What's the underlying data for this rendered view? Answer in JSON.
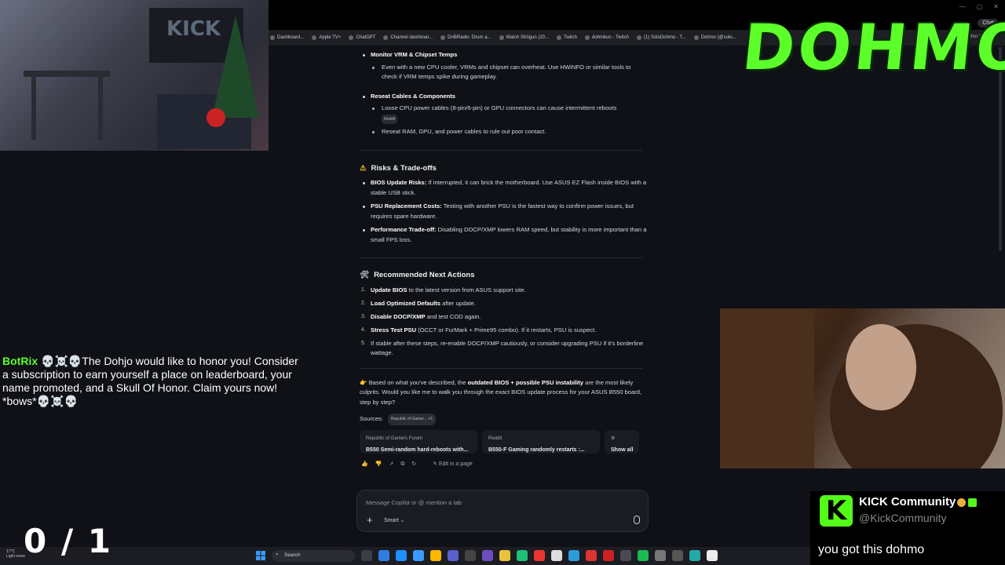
{
  "browser": {
    "bookmarks": [
      "Dashboard...",
      "Apple TV+",
      "ChatGPT",
      "Channel dashboar...",
      "DnBRadio: Drum a...",
      "Watch Shōgun (20...",
      "Twitch",
      "dohmkun - Twitch",
      "(1) SoloDohmo - T...",
      "Dohmo (@solo..."
    ],
    "chat_button": "Chat",
    "other_favorites": "Other favorites"
  },
  "copilot": {
    "top_items": [
      {
        "title": "Monitor VRM & Chipset Temps",
        "bullets": [
          "Even with a new CPU cooler, VRMs and chipset can overheat. Use HWiNFO or similar tools to check if VRM temps spike during gameplay."
        ]
      },
      {
        "title": "Reseat Cables & Components",
        "bullets": [
          "Loose CPU power cables (8-pin/6-pin) or GPU connectors can cause intermittent reboots",
          "Reseat RAM, GPU, and power cables to rule out poor contact."
        ],
        "tag": "Reddit"
      }
    ],
    "risks": {
      "heading": "Risks & Trade-offs",
      "items": [
        {
          "bold": "BIOS Update Risks:",
          "text": " If interrupted, it can brick the motherboard. Use ASUS EZ Flash inside BIOS with a stable USB stick."
        },
        {
          "bold": "PSU Replacement Costs:",
          "text": " Testing with another PSU is the fastest way to confirm power issues, but requires spare hardware."
        },
        {
          "bold": "Performance Trade-off:",
          "text": " Disabling DOCP/XMP lowers RAM speed, but stability is more important than a small FPS loss."
        }
      ]
    },
    "next": {
      "heading": "Recommended Next Actions",
      "items": [
        {
          "n": "1.",
          "bold": "Update BIOS",
          "text": " to the latest version from ASUS support site."
        },
        {
          "n": "2.",
          "bold": "Load Optimized Defaults",
          "text": " after update."
        },
        {
          "n": "3.",
          "bold": "Disable DOCP/XMP",
          "text": " and test COD again."
        },
        {
          "n": "4.",
          "bold": "Stress Test PSU",
          "text": " (OCCT or FurMark + Prime95 combo). If it restarts, PSU is suspect."
        },
        {
          "n": "5.",
          "bold": "",
          "text": "If stable after these steps, re-enable DOCP/XMP cautiously, or consider upgrading PSU if it's borderline wattage."
        }
      ]
    },
    "summary": {
      "lead": "👉 Based on what you've described, the ",
      "bold": "outdated BIOS + possible PSU instability",
      "rest": " are the most likely culprits. Would you like me to walk you through the exact BIOS update process for your ASUS B550 board, step by step?"
    },
    "sources_label": "Sources:",
    "sources_pill": "Republic of Gamer... +3",
    "cards": [
      {
        "site": "Republic of Gamers Forum",
        "title": "B550 Semi-random hard-reboots with..."
      },
      {
        "site": "Reddit",
        "title": "B550-F Gaming randomly restarts :..."
      },
      {
        "site": "",
        "title": "Show all"
      }
    ],
    "edit_label": "Edit in a page",
    "composer_placeholder": "Message Copilot or @ mention a tab",
    "smart_label": "Smart"
  },
  "taskbar": {
    "search_label": "Search",
    "weather_temp": "17°C",
    "weather_desc": "Light snow"
  },
  "stream": {
    "logo_text": "DOHMO",
    "chat_user": "BotRix",
    "chat_text": " 💀☠️💀The Dohjo would like to honor you! Consider a subscription to earn yourself a place on leaderboard, your name promoted, and a Skull Of Honor. Claim yours now! *bows*💀☠️💀",
    "counter": "0 / 1",
    "kick_name": "KICK Community",
    "kick_handle": "@KickCommunity",
    "kick_msg": "you got this dohmo"
  },
  "colors": {
    "accent_green": "#53fc18",
    "bg": "#0f1117"
  }
}
